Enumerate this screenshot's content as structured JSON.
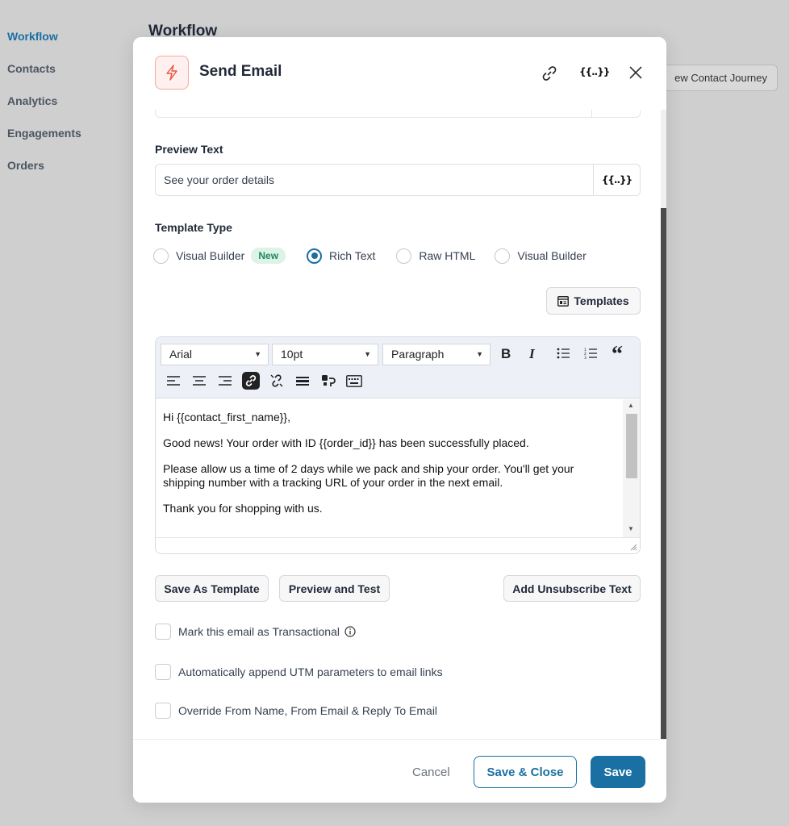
{
  "sidebar": {
    "items": [
      {
        "label": "Workflow"
      },
      {
        "label": "Contacts"
      },
      {
        "label": "Analytics"
      },
      {
        "label": "Engagements"
      },
      {
        "label": "Orders"
      }
    ]
  },
  "page": {
    "title": "Workflow",
    "journey_button": "ew Contact Journey"
  },
  "modal": {
    "title": "Send Email",
    "code_icon_text": "{{..}}",
    "preview_text": {
      "label": "Preview Text",
      "value": "See your order details",
      "merge_tag_button": "{{..}}"
    },
    "template_type": {
      "label": "Template Type",
      "options": [
        {
          "label": "Visual Builder",
          "badge": "New",
          "selected": false
        },
        {
          "label": "Rich Text",
          "selected": true
        },
        {
          "label": "Raw HTML",
          "selected": false
        },
        {
          "label": "Visual Builder",
          "selected": false
        }
      ]
    },
    "templates_button": "Templates",
    "editor": {
      "font": "Arial",
      "size": "10pt",
      "block": "Paragraph",
      "paragraphs": [
        "Hi {{contact_first_name}},",
        "Good news! Your order with ID {{order_id}} has been successfully placed.",
        "Please allow us a time of 2 days while we pack and ship your order. You'll get your shipping number with a tracking URL of your order in the next email.",
        "Thank you for shopping with us."
      ]
    },
    "actions": {
      "save_template": "Save As Template",
      "preview_test": "Preview and Test",
      "unsubscribe": "Add Unsubscribe Text"
    },
    "checkboxes": [
      {
        "label": "Mark this email as Transactional",
        "checked": false
      },
      {
        "label": "Automatically append UTM parameters to email links",
        "checked": false
      },
      {
        "label": "Override From Name, From Email & Reply To Email",
        "checked": false
      }
    ],
    "footer": {
      "cancel": "Cancel",
      "save_close": "Save & Close",
      "save": "Save"
    }
  },
  "colors": {
    "accent": "#1a6fa3",
    "new_badge_bg": "#dcf3e8",
    "new_badge_text": "#1e8a59"
  }
}
